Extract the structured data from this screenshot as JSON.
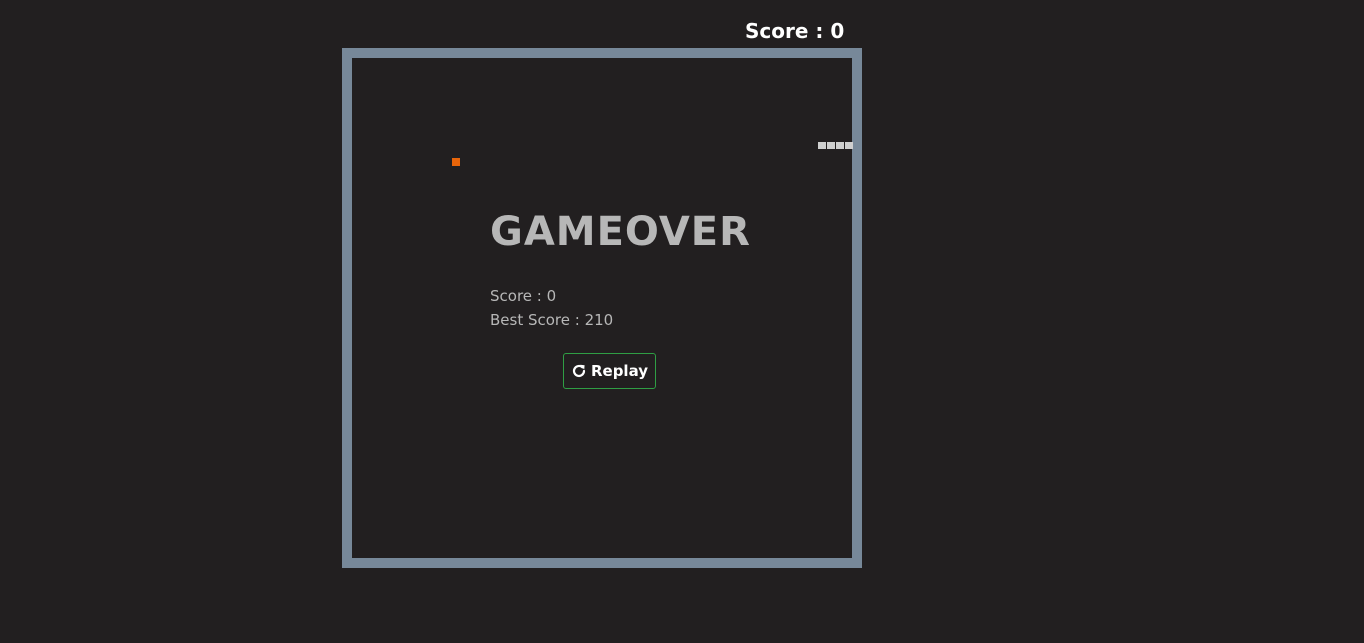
{
  "header": {
    "score_label": "Score",
    "score_separator": " : ",
    "score_value": "0"
  },
  "board": {
    "border_color": "#778899",
    "food_color": "#e8650a",
    "snake_color": "#cfcfcf",
    "snake_segments": 4
  },
  "gameover": {
    "title": "GAMEOVER",
    "score_text": "Score : 0",
    "best_score_text": "Best Score : 210",
    "replay_label": "Replay",
    "replay_icon": "redo-icon",
    "replay_border_color": "#2f9e44"
  }
}
